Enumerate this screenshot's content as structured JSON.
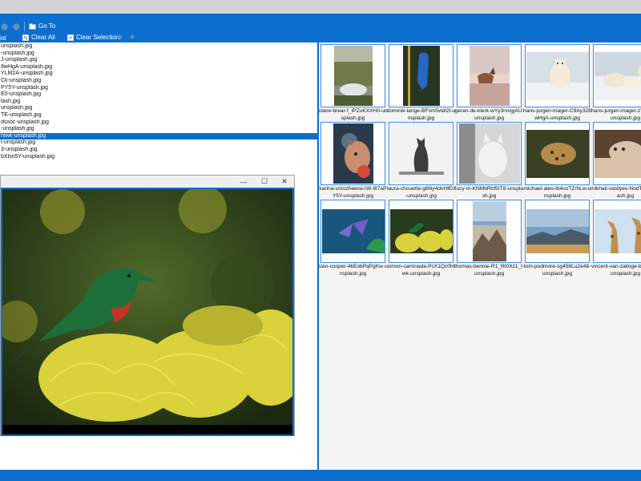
{
  "toolbar": {
    "goto_label": "Go To",
    "list_label": "ist",
    "clear_all_label": "Clear All",
    "clear_selection_label": "Clear Selection"
  },
  "file_list": {
    "items": [
      "unsplash.jpg",
      "-unsplash.jpg",
      "J-unsplash.jpg",
      "8wHgA-unsplash.jpg",
      "YLM2A-unsplash.jpg",
      "Ck-unsplash.jpg",
      "PY5Y-unsplash.jpg",
      "E0-unsplash.jpg",
      "lash.jpg",
      "unsplash.jpg",
      "TE-unsplash.jpg",
      "dsxoc-unsplash.jpg",
      "-unsplash.jpg",
      "htwk-unsplash.jpg",
      "l-unsplash.jpg",
      "3-unsplash.jpg",
      "bXlsn5Y-unsplash.jpg"
    ],
    "selected_index": 13
  },
  "thumbnails": [
    {
      "caption": "claire-brear-f_tPZuKXXH0-unsplash.jpg"
    },
    {
      "caption": "dominik-lange-BFsm5vldl2t-unsplash.jpg"
    },
    {
      "caption": "geran-de-klerk-wYy3rvvgjAU-unsplash.jpg"
    },
    {
      "caption": "hans-jurgen-mager-C9Ay328wHgA-unsplash.jpg"
    },
    {
      "caption": "hans-jurgen-mager-zYLM2A-unsplash.jpg"
    },
    {
      "caption": "karina-vorozheeva-rW-I87aPY5Y-unsplash.jpg"
    },
    {
      "caption": "laura-chouette-g6Ny4dvHIE0-unsplash.jpg"
    },
    {
      "caption": "lucy-m-KNMbRhf5IT8-unsplash.jpg"
    },
    {
      "caption": "michael-aleo-tb4usTZrhLw-unsplash.jpg"
    },
    {
      "caption": "mikhail-vasilyev-NodTE-unsplash.jpg"
    },
    {
      "caption": "sian-cooper-4kEobPqPgKw-unsplash.jpg"
    },
    {
      "caption": "simon-caminada-PcX1Qc0htwk-unsplash.jpg"
    },
    {
      "caption": "thomas-bennie-R1_Rt0Xz1_l-unsplash.jpg"
    },
    {
      "caption": "tom-podmore-sg458Lu2e48-unsplash.jpg"
    },
    {
      "caption": "vincent-van-zalinge-bXlsn5Y-unsplash.jpg"
    }
  ],
  "viewer": {
    "minimize_glyph": "—",
    "maximize_glyph": "☐",
    "close_glyph": "✕"
  },
  "colors": {
    "accent": "#0b6fd0",
    "selection": "#0b6fd0",
    "thumb_border": "#3a8ee6"
  }
}
